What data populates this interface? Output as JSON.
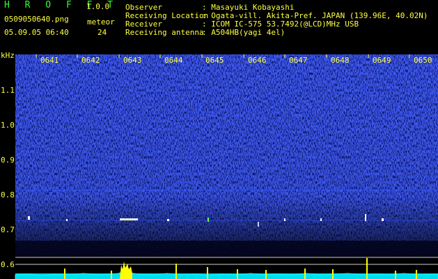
{
  "header": {
    "app_title": "H R O F F T",
    "version": "1.0.0",
    "filename": "0509050640.png",
    "meteor_label": "meteor",
    "datetime": "05.09.05 06:40",
    "meteor_count": "24"
  },
  "info": [
    {
      "label": "Observer",
      "value": ": Masayuki Kobayashi"
    },
    {
      "label": "Receiving Location",
      "value": ": Ogata-vill. Akita-Pref. JAPAN (139.96E, 40.02N)"
    },
    {
      "label": "Receiver",
      "value": ": ICOM IC-575 53.7492(@LCD)MHz USB"
    },
    {
      "label": "Receiving antenna",
      "value": ": A504HB(yagi 4el)"
    }
  ],
  "chart_data": {
    "type": "heatmap",
    "ylabel": "kHz",
    "x_ticks": [
      "0641",
      "0642",
      "0643",
      "0644",
      "0645",
      "0646",
      "0647",
      "0648",
      "0649",
      "0650"
    ],
    "y_ticks": [
      "1.1",
      "1.0",
      "0.9",
      "0.8",
      "0.7",
      "0.6"
    ],
    "colors": {
      "background": "#000000",
      "noise": "#1a3cff",
      "bright": "#ffffff",
      "meteor": "#ffff00",
      "level": "#00ffff",
      "grid": "#ffffff"
    }
  }
}
